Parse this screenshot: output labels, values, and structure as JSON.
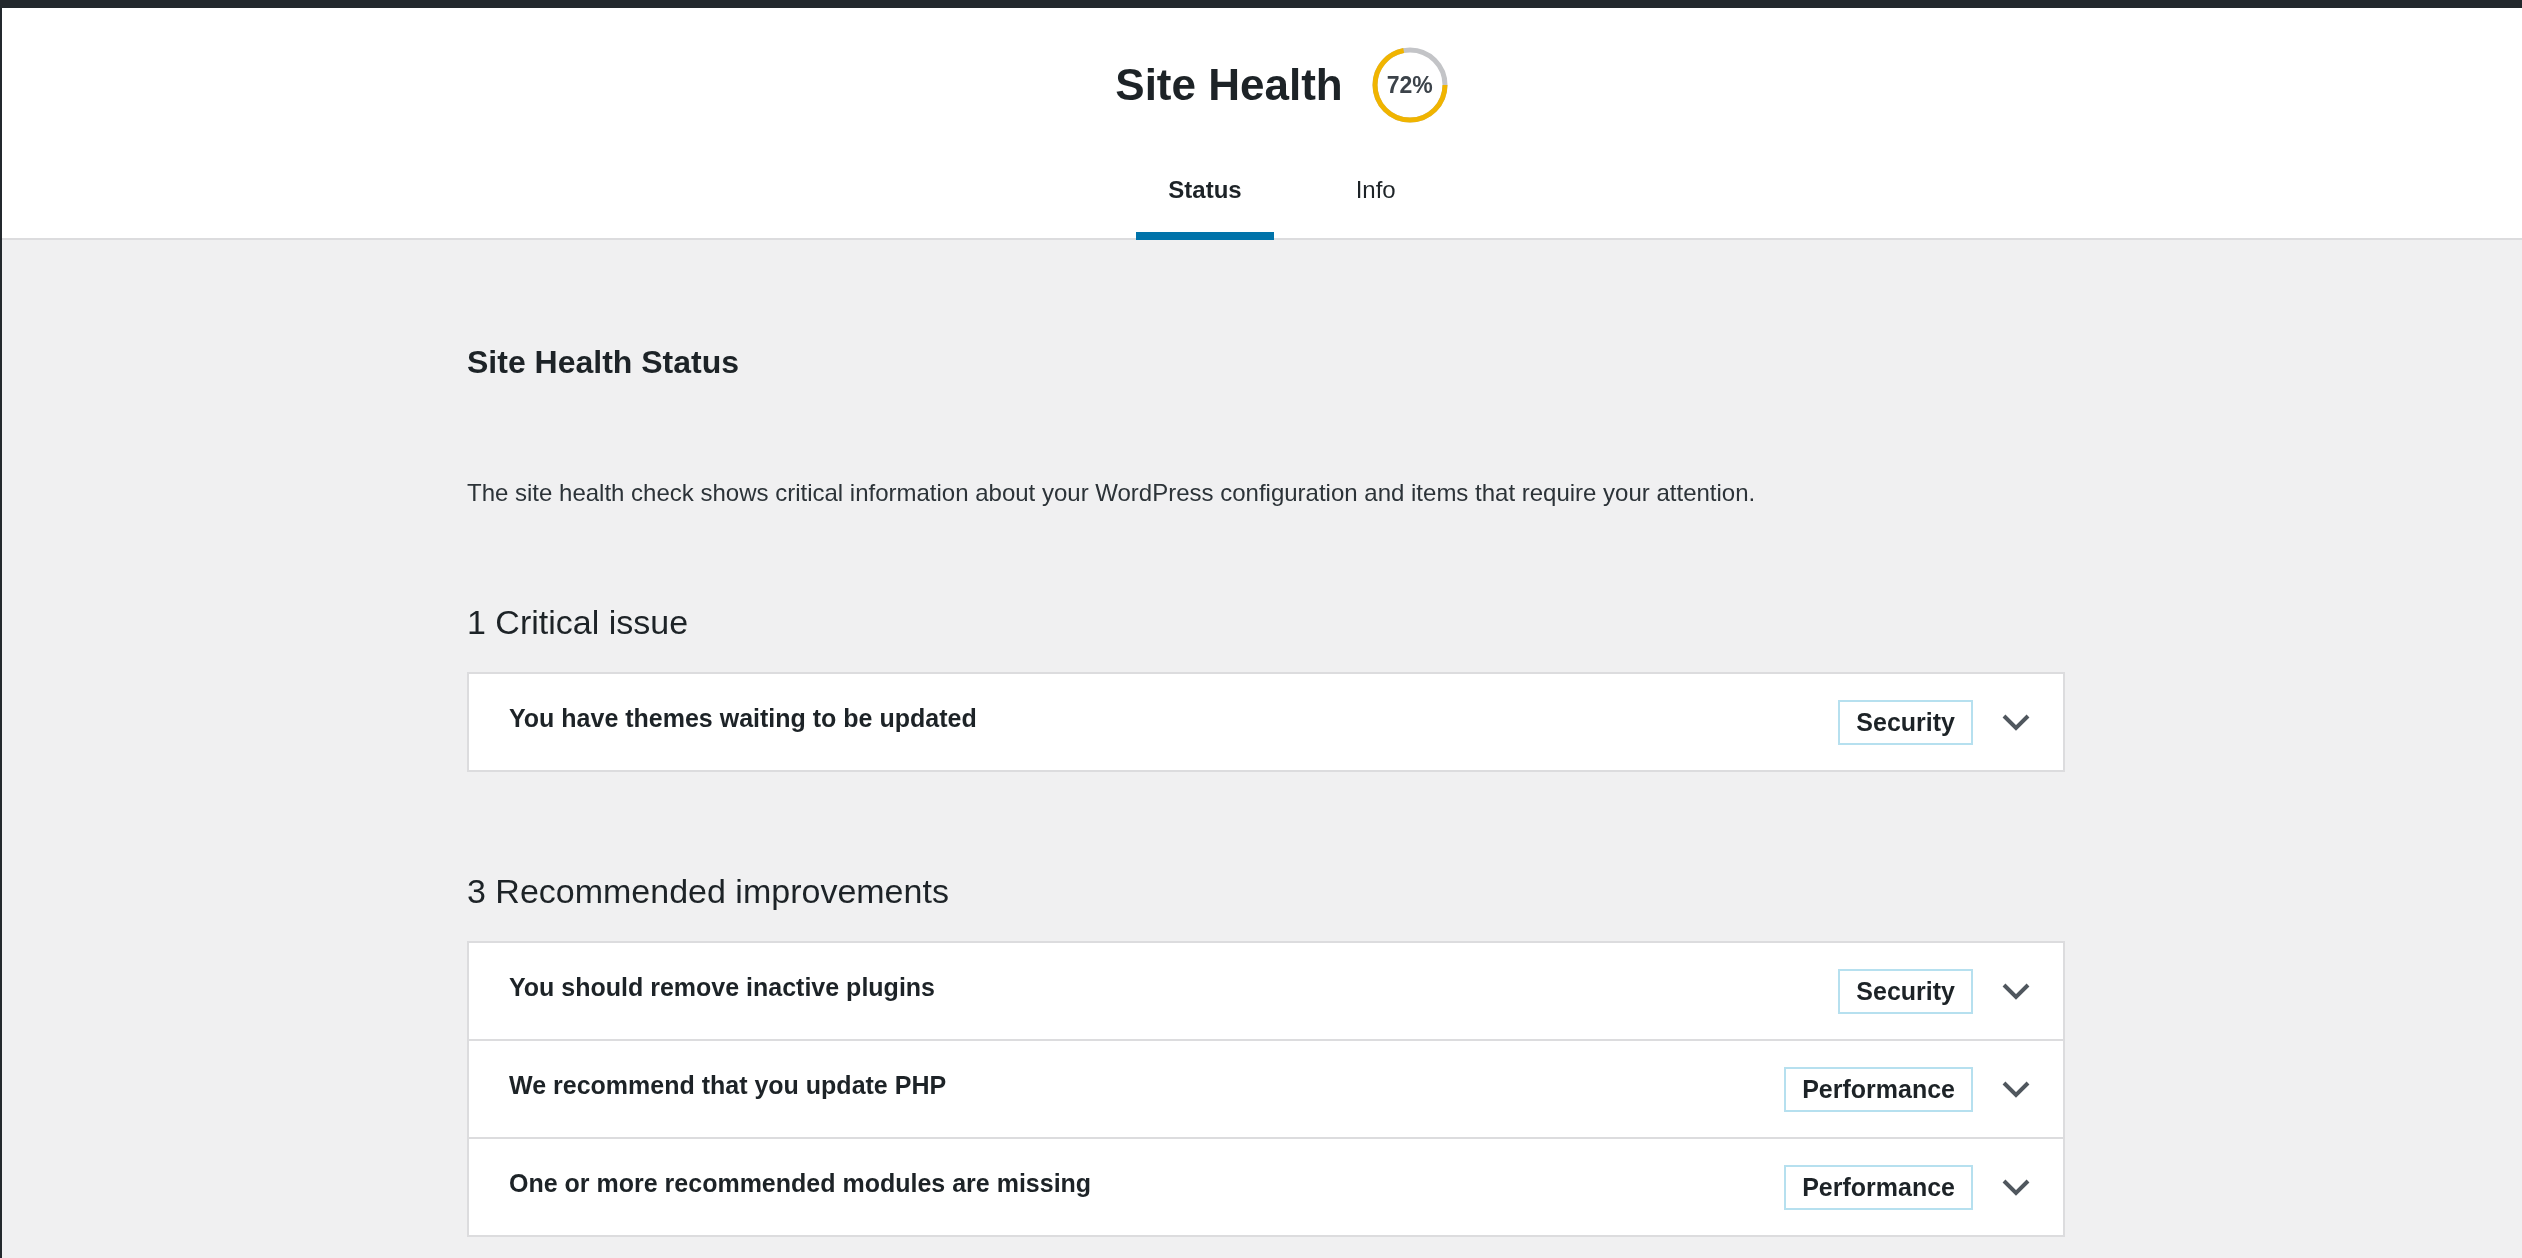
{
  "header": {
    "title": "Site Health",
    "score": {
      "text": "72%",
      "level": 0.72
    }
  },
  "tabs": [
    {
      "label": "Status",
      "selected": true
    },
    {
      "label": "Info",
      "selected": false
    }
  ],
  "content": {
    "title": "Site Health Status",
    "description": "The site health check shows critical information about your WordPress configuration and items that require your attention.",
    "groups": [
      {
        "heading": "1 Critical issue",
        "items": [
          {
            "title": "You have themes waiting to be updated",
            "badge": "Security",
            "expanded": false
          }
        ]
      },
      {
        "heading": "3 Recommended improvements",
        "items": [
          {
            "title": "You should remove inactive plugins",
            "badge": "Security",
            "expanded": false
          },
          {
            "title": "We recommend that you update PHP",
            "badge": "Performance",
            "expanded": false
          },
          {
            "title": "One or more recommended modules are missing",
            "badge": "Performance",
            "expanded": false
          }
        ]
      }
    ]
  }
}
